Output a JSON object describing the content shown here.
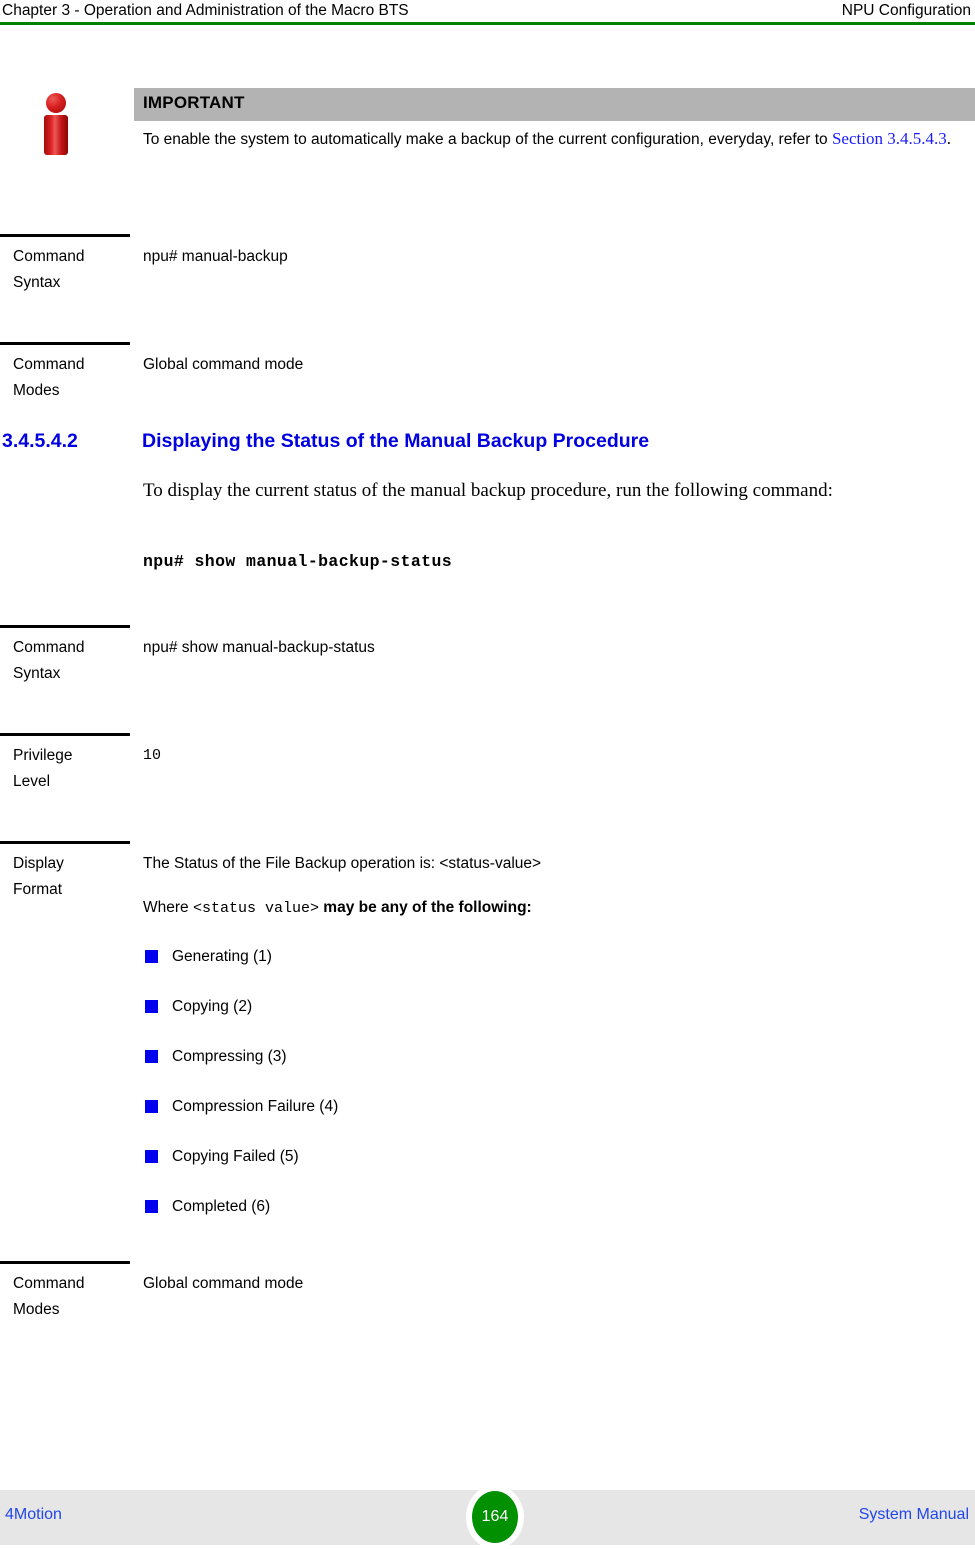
{
  "header": {
    "left": "Chapter 3 - Operation and Administration of the Macro BTS",
    "right": "NPU Configuration",
    "rule_color": "#008000"
  },
  "callout": {
    "icon": "info-icon",
    "title": "IMPORTANT",
    "bar_color": "#b3b3b3",
    "text_before_link": "To enable the system to automatically make a backup of the current configuration, everyday, refer to ",
    "link_text": "Section 3.4.5.4.3",
    "text_after_link": ".",
    "link_color": "#1a1aff"
  },
  "rows": [
    {
      "label_line1": "Command",
      "label_line2": "Syntax",
      "content": "npu# manual-backup",
      "content_style": "sans"
    },
    {
      "label_line1": "Command",
      "label_line2": "Modes",
      "content": "Global command mode",
      "content_style": "sans"
    }
  ],
  "section": {
    "number": "3.4.5.4.2",
    "title": "Displaying the Status of the Manual Backup Procedure",
    "color": "#0000E0"
  },
  "paragraph": {
    "text": "To display the current status of the manual backup procedure, run the following command:"
  },
  "command_line": {
    "text": "npu# show manual-backup-status"
  },
  "rows2": [
    {
      "label_line1": "Command",
      "label_line2": "Syntax",
      "content": "npu# show manual-backup-status",
      "content_style": "sans"
    },
    {
      "label_line1": "Privilege",
      "label_line2": "Level",
      "content": "10",
      "content_style": "mono"
    }
  ],
  "display_format": {
    "label_line1": "Display",
    "label_line2": "Format",
    "line1": "The Status of the File Backup operation is: <status-value>",
    "line2_prefix": "Where ",
    "line2_mono": "<status value>",
    "line2_suffix": " may be any of the following:",
    "bullet_color": "#0000EE",
    "items": [
      "Generating (1)",
      "Copying (2)",
      "Compressing (3)",
      "Compression Failure (4)",
      "Copying Failed (5)",
      "Completed (6)"
    ]
  },
  "last_row": {
    "label_line1": "Command",
    "label_line2": "Modes",
    "content": "Global command mode"
  },
  "footer": {
    "left": "4Motion",
    "page_number": "164",
    "right": "System Manual",
    "band_color": "#e6e6e6",
    "page_circle_color": "#009000",
    "link_color": "#2246e8"
  }
}
